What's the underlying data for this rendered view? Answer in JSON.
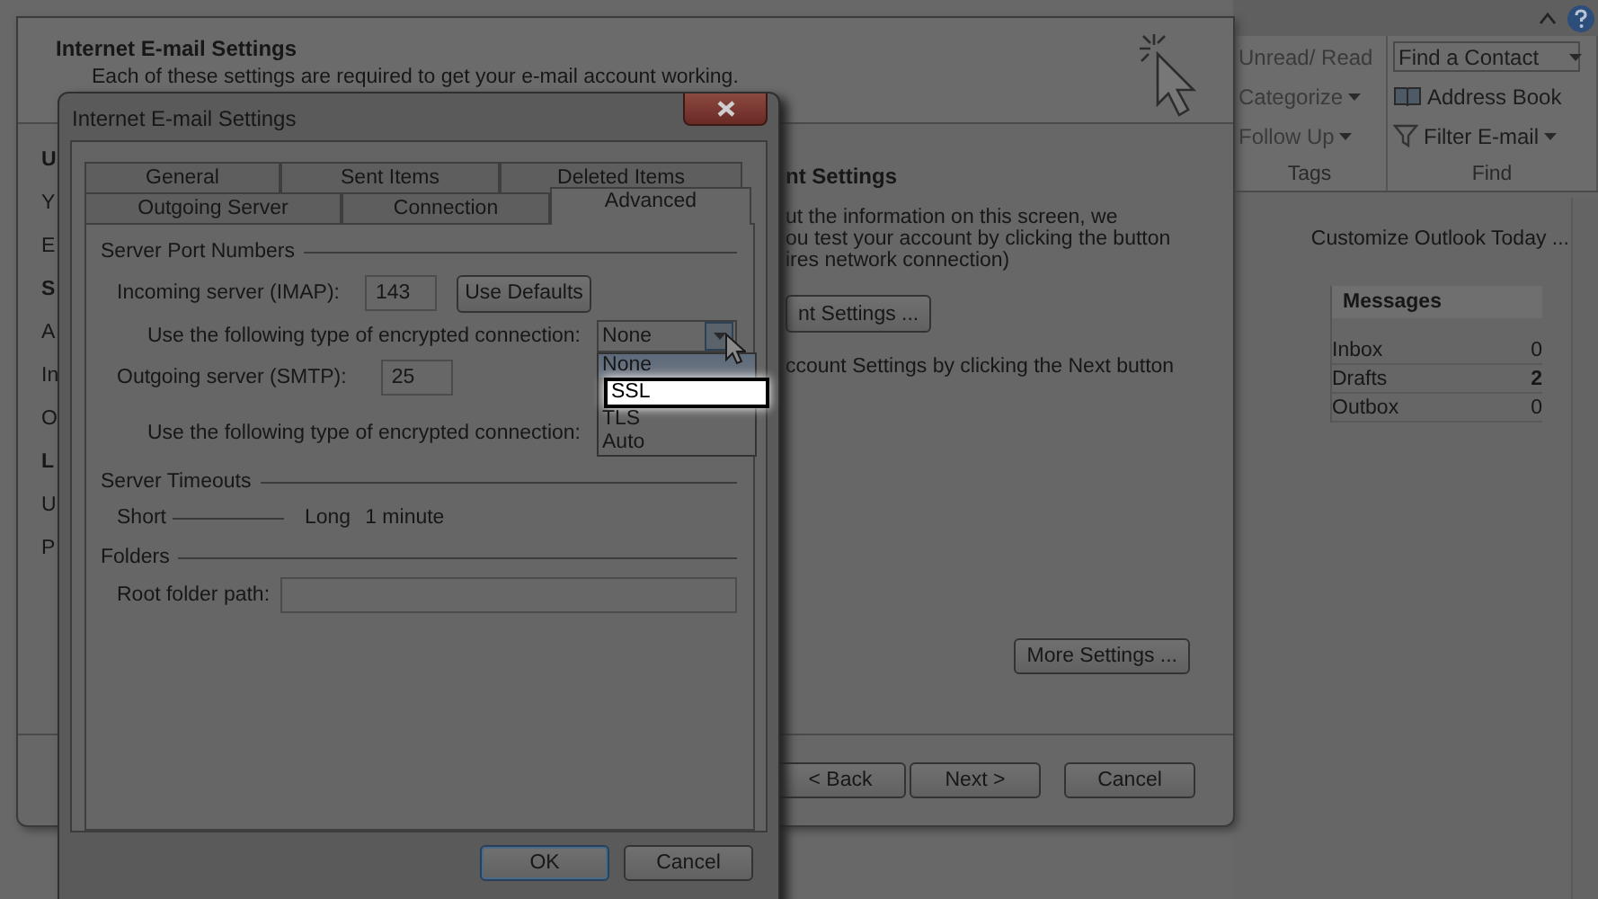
{
  "outlook": {
    "ribbon": {
      "groups": [
        {
          "label": "Tags",
          "buttons": [
            {
              "label": "Unread/ Read",
              "menu": false
            },
            {
              "label": "Categorize",
              "menu": true
            },
            {
              "label": "Follow Up",
              "menu": true
            }
          ]
        },
        {
          "label": "Find",
          "search": {
            "placeholder": "Find a Contact"
          },
          "buttons": [
            {
              "label": "Address Book",
              "menu": false
            },
            {
              "label": "Filter E-mail",
              "menu": true
            }
          ]
        }
      ]
    },
    "customize_link": "Customize Outlook Today ...",
    "messages": {
      "title": "Messages",
      "rows": [
        {
          "name": "Inbox",
          "count": "0",
          "unread": false
        },
        {
          "name": "Drafts",
          "count": "2",
          "unread": true
        },
        {
          "name": "Outbox",
          "count": "0",
          "unread": false
        }
      ]
    }
  },
  "wizard": {
    "title": "Internet E-mail Settings",
    "subtitle": "Each of these settings are required to get your e-mail account working.",
    "left_fragments": [
      {
        "kind": "heading",
        "text": "U"
      },
      {
        "kind": "text",
        "text": "Y"
      },
      {
        "kind": "text",
        "text": "E"
      },
      {
        "kind": "heading",
        "text": "S"
      },
      {
        "kind": "text",
        "text": "A"
      },
      {
        "kind": "text",
        "text": "In"
      },
      {
        "kind": "text",
        "text": "O"
      },
      {
        "kind": "heading",
        "text": "L"
      },
      {
        "kind": "text",
        "text": "U"
      },
      {
        "kind": "text",
        "text": "P"
      }
    ],
    "right_heading": "nt Settings",
    "right_lines": [
      "ut the information on this screen, we",
      "ou test your account by clicking the button",
      "ires network connection)"
    ],
    "test_button": "nt Settings ...",
    "next_note": "ccount Settings by clicking the Next button",
    "more_settings": "More Settings ...",
    "nav_buttons": [
      "< Back",
      "Next >",
      "Cancel"
    ]
  },
  "dialog": {
    "title": "Internet E-mail Settings",
    "tab_rows": [
      [
        {
          "label": "General",
          "selected": false
        },
        {
          "label": "Sent Items",
          "selected": false
        },
        {
          "label": "Deleted Items",
          "selected": false
        }
      ],
      [
        {
          "label": "Outgoing Server",
          "selected": false
        },
        {
          "label": "Connection",
          "selected": false
        },
        {
          "label": "Advanced",
          "selected": true
        }
      ]
    ],
    "ports": {
      "title": "Server Port Numbers",
      "incoming_label": "Incoming server (IMAP):",
      "incoming_port": "143",
      "defaults_button": "Use Defaults",
      "encryption_label": "Use the following type of encrypted connection:",
      "encryption_value": "None",
      "encryption_open": true,
      "options": [
        {
          "label": "None",
          "selected": true,
          "callout": false
        },
        {
          "label": "SSL",
          "selected": false,
          "callout": true
        },
        {
          "label": "TLS",
          "selected": false,
          "callout": false
        },
        {
          "label": "Auto",
          "selected": false,
          "callout": false
        }
      ],
      "outgoing_label": "Outgoing server (SMTP):",
      "outgoing_port": "25",
      "encryption_label_2": "Use the following type of encrypted connection:"
    },
    "timeouts": {
      "title": "Server Timeouts",
      "min_label": "Short",
      "max_label": "Long",
      "reading": "1 minute"
    },
    "folders": {
      "title": "Folders",
      "root_label": "Root folder path:"
    },
    "buttons": [
      {
        "label": "OK",
        "default": true
      },
      {
        "label": "Cancel",
        "default": false
      }
    ]
  }
}
